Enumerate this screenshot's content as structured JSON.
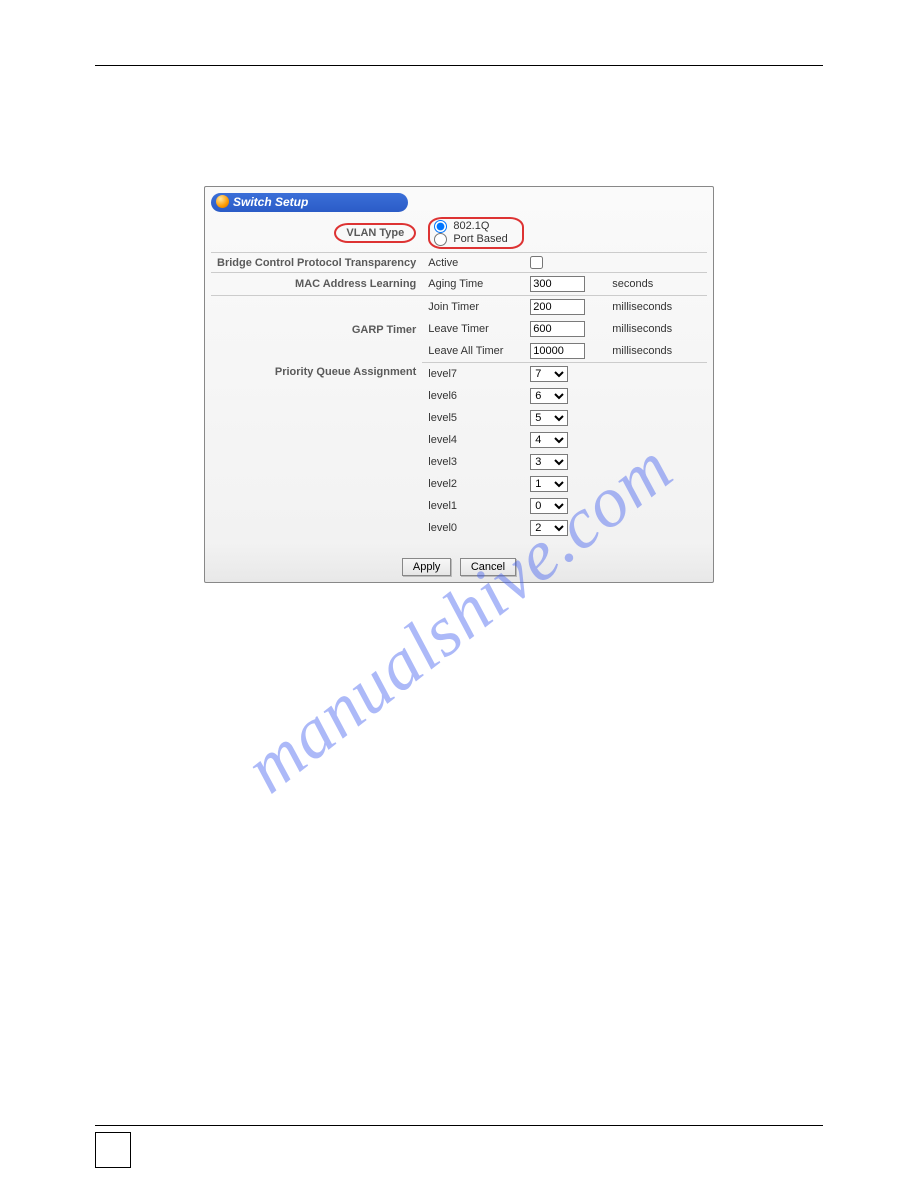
{
  "panel": {
    "title": "Switch Setup",
    "rows": {
      "vlan_type": {
        "label": "VLAN Type",
        "opt1": "802.1Q",
        "opt2": "Port Based"
      },
      "bcp": {
        "label": "Bridge Control Protocol Transparency",
        "field": "Active"
      },
      "mac_learn": {
        "label": "MAC Address Learning",
        "field": "Aging Time",
        "value": "300",
        "unit": "seconds"
      },
      "garp": {
        "label": "GARP Timer",
        "join": {
          "field": "Join Timer",
          "value": "200",
          "unit": "milliseconds"
        },
        "leave": {
          "field": "Leave Timer",
          "value": "600",
          "unit": "milliseconds"
        },
        "leave_all": {
          "field": "Leave All Timer",
          "value": "10000",
          "unit": "milliseconds"
        }
      },
      "pqa": {
        "label": "Priority Queue Assignment",
        "levels": [
          {
            "field": "level7",
            "value": "7"
          },
          {
            "field": "level6",
            "value": "6"
          },
          {
            "field": "level5",
            "value": "5"
          },
          {
            "field": "level4",
            "value": "4"
          },
          {
            "field": "level3",
            "value": "3"
          },
          {
            "field": "level2",
            "value": "1"
          },
          {
            "field": "level1",
            "value": "0"
          },
          {
            "field": "level0",
            "value": "2"
          }
        ]
      }
    },
    "buttons": {
      "apply": "Apply",
      "cancel": "Cancel"
    }
  },
  "watermark": "manualshive.com"
}
